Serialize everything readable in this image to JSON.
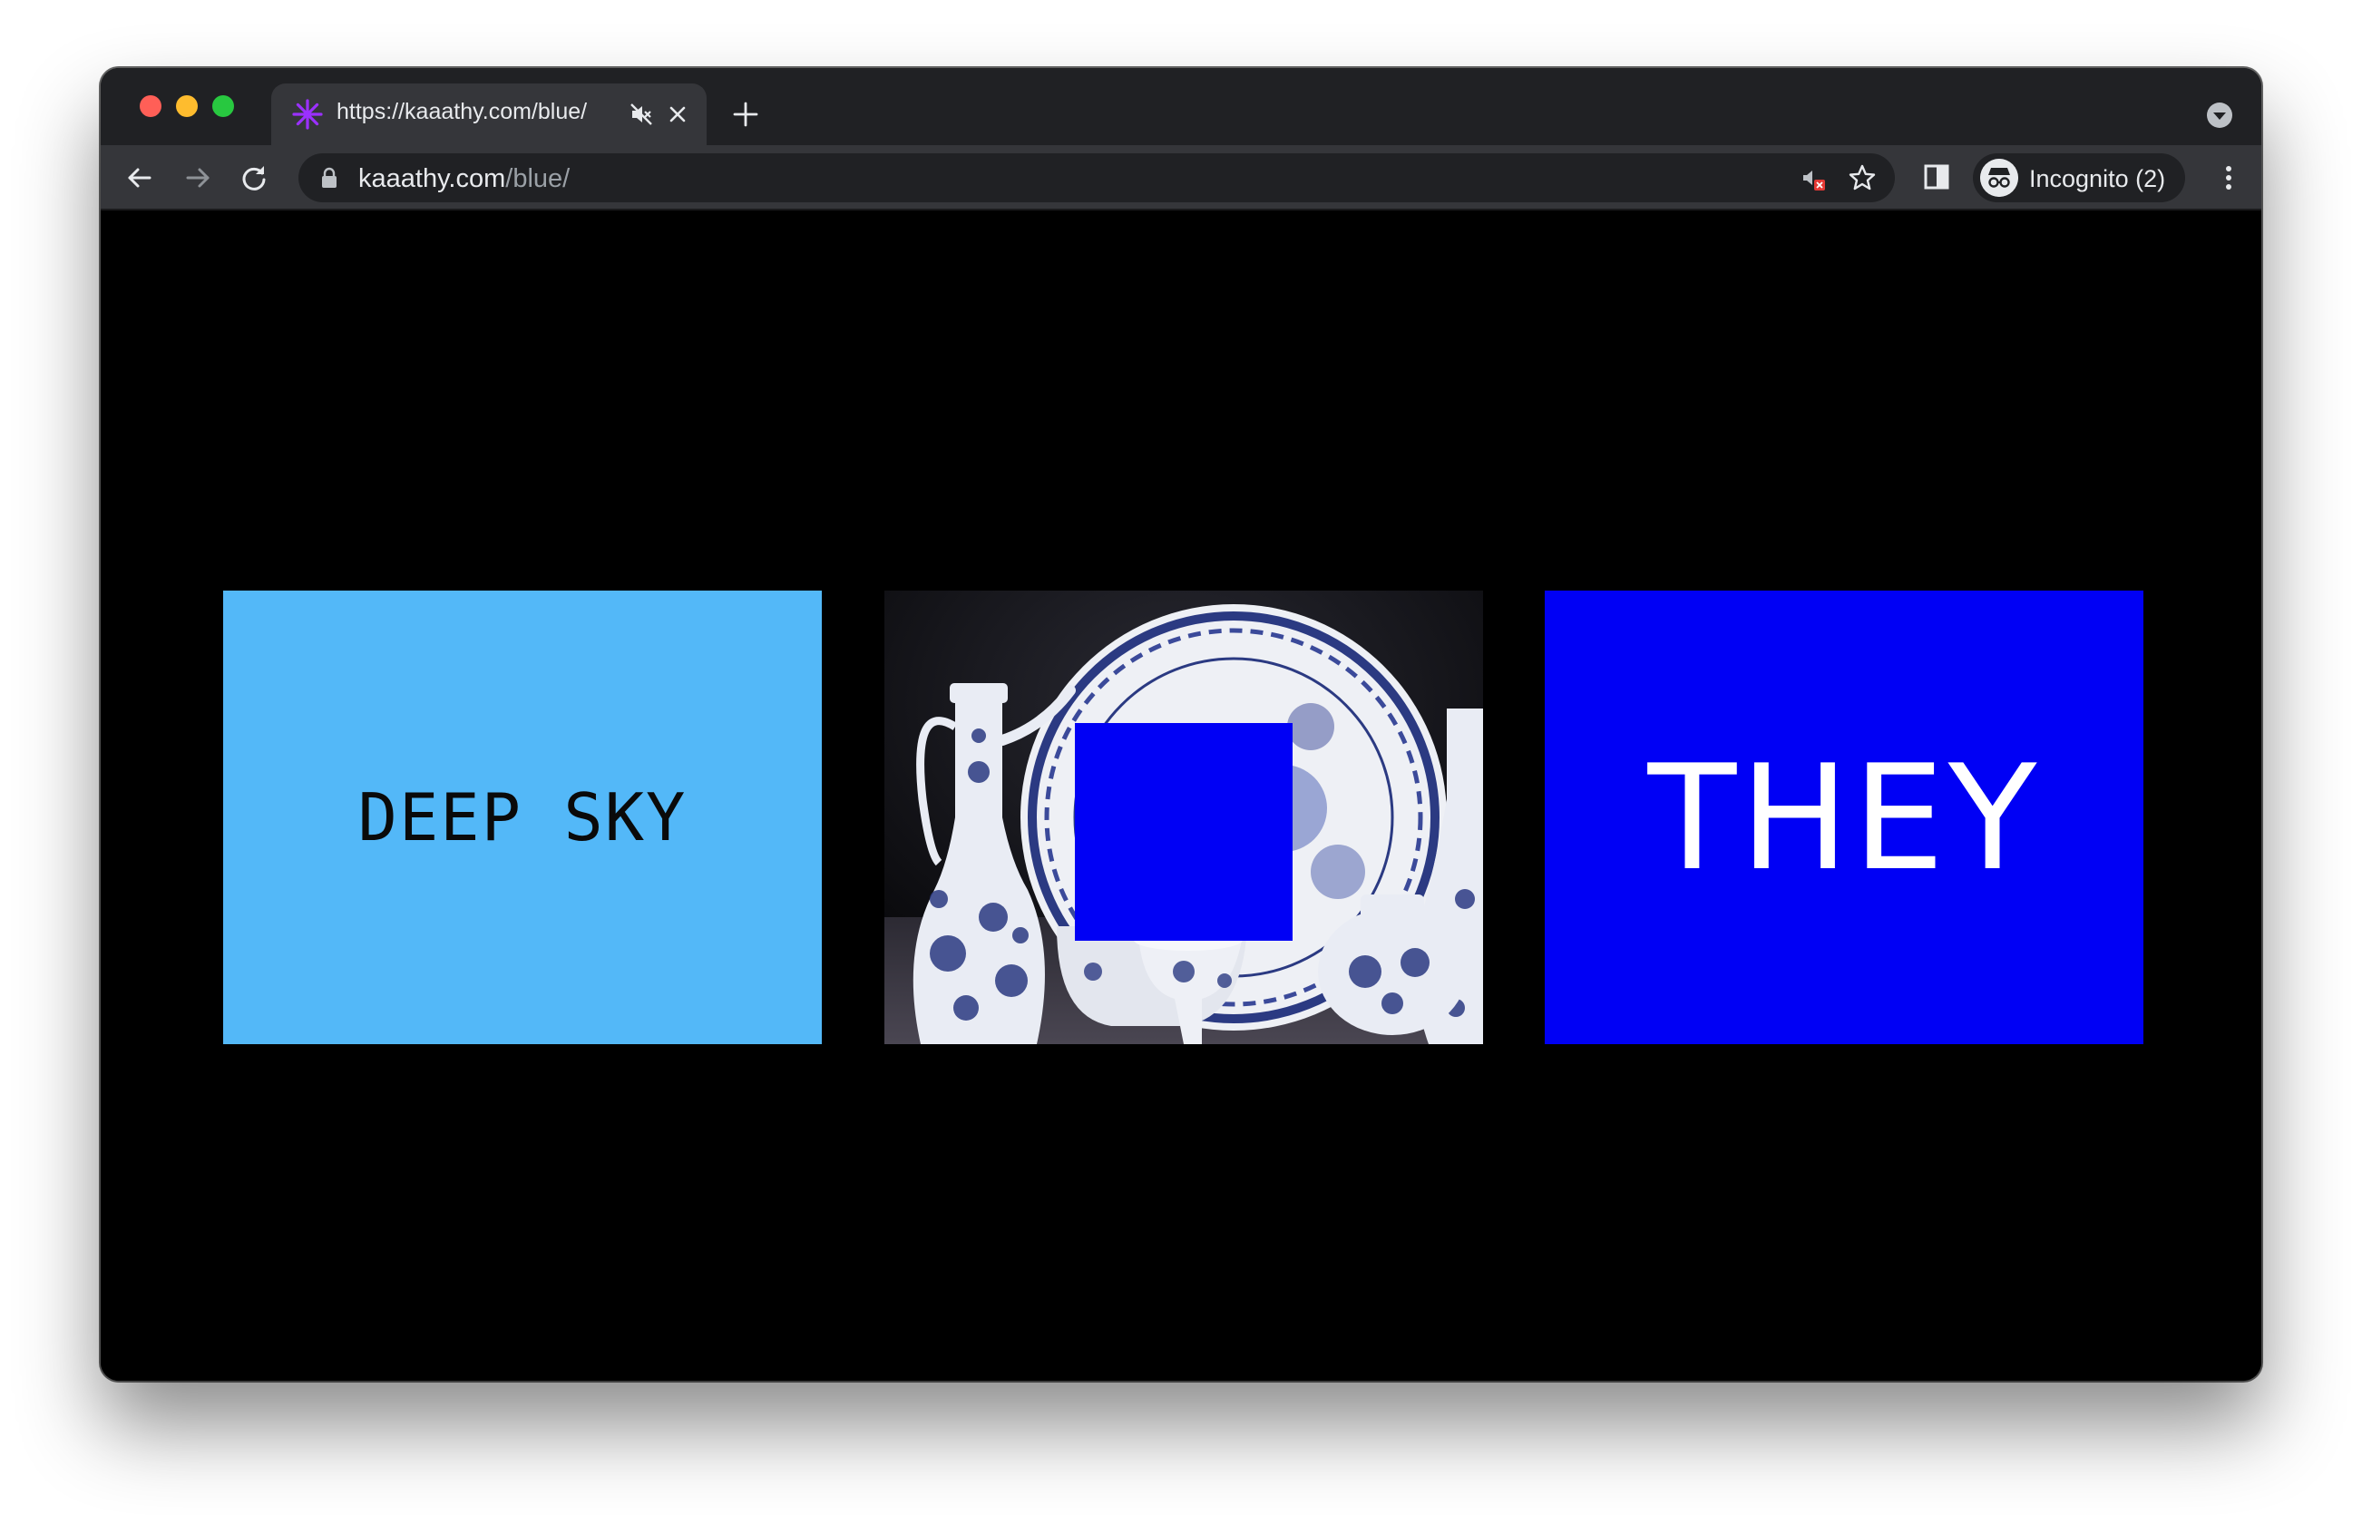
{
  "browser": {
    "tab": {
      "title": "https://kaaathy.com/blue/",
      "favicon": "asterisk-icon",
      "favicon_color": "#9b30ff"
    },
    "address": {
      "host": "kaaathy.com",
      "path": "/blue/"
    },
    "profile_label": "Incognito (2)"
  },
  "page": {
    "panels": [
      {
        "text": "DEEP SKY",
        "background": "#53b8f8",
        "text_color": "#0a0a0a"
      },
      {
        "image": "blue-and-white porcelain",
        "overlay_color": "#0000f5"
      },
      {
        "text": "THEY",
        "background": "#0000f5",
        "text_color": "#ffffff"
      }
    ]
  }
}
